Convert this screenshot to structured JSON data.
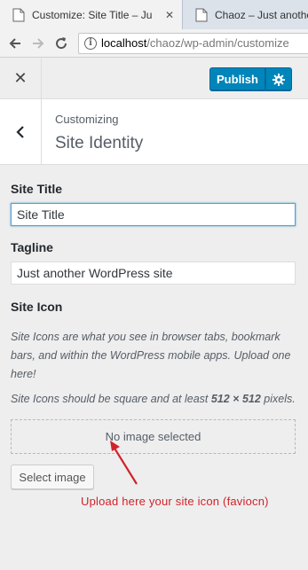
{
  "browser": {
    "tabs": [
      {
        "title": "Customize: Site Title – Ju",
        "active": true
      },
      {
        "title": "Chaoz – Just another",
        "active": false
      }
    ],
    "url_host": "localhost",
    "url_path": "/chaoz/wp-admin/customize"
  },
  "header": {
    "close_symbol": "✕",
    "publish_label": "Publish",
    "accent_color": "#0085ba"
  },
  "section": {
    "subtitle": "Customizing",
    "title": "Site Identity"
  },
  "site_title": {
    "label": "Site Title",
    "value": "Site Title"
  },
  "tagline": {
    "label": "Tagline",
    "value": "Just another WordPress site"
  },
  "site_icon": {
    "label": "Site Icon",
    "description1": "Site Icons are what you see in browser tabs, bookmark bars, and within the WordPress mobile apps. Upload one here!",
    "description2_pre": "Site Icons should be square and at least ",
    "description2_dims": "512 × 512",
    "description2_post": " pixels.",
    "placeholder": "No image selected",
    "select_label": "Select image"
  },
  "annotation": {
    "text": "Upload here your site icon (faviocn)",
    "color": "#d0232a"
  }
}
